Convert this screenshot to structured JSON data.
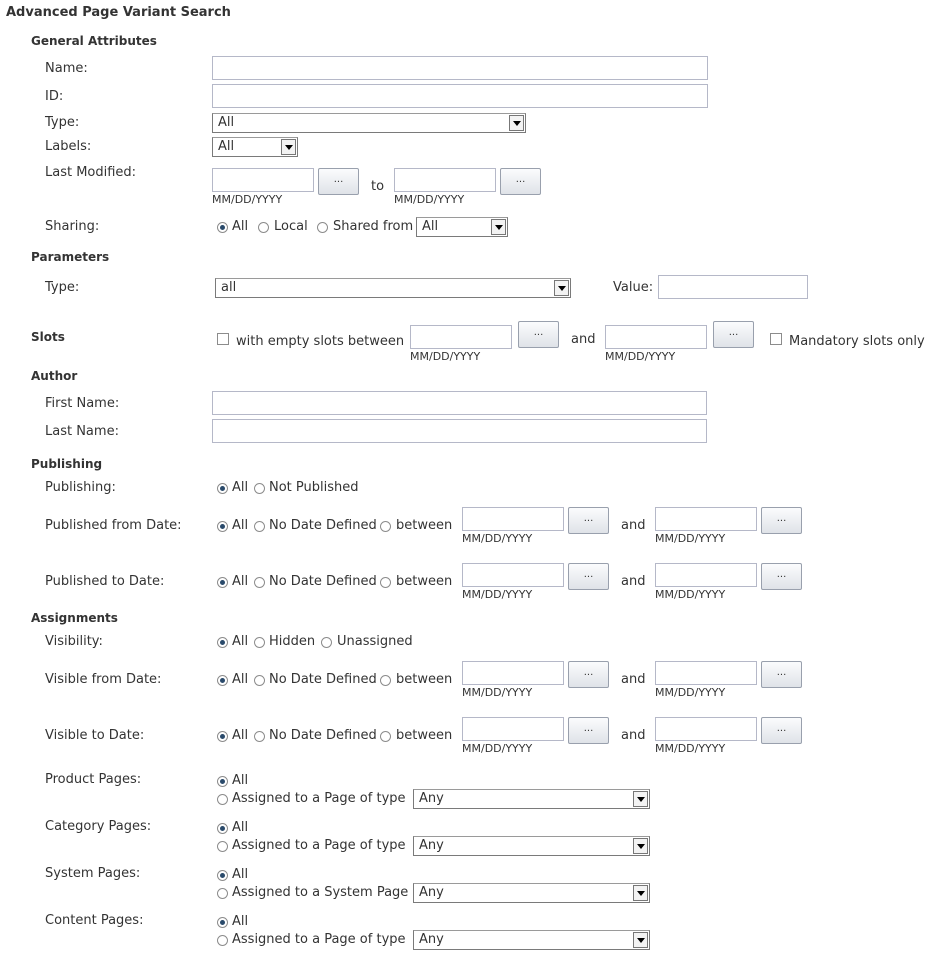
{
  "title": "Advanced Page Variant Search",
  "date_hint": "MM/DD/YYYY",
  "picker_label": "...",
  "general": {
    "heading": "General Attributes",
    "name_label": "Name:",
    "id_label": "ID:",
    "type_label": "Type:",
    "type_value": "All",
    "labels_label": "Labels:",
    "labels_value": "All",
    "last_modified_label": "Last Modified:",
    "to_label": "to",
    "sharing_label": "Sharing:",
    "sharing_options": [
      "All",
      "Local",
      "Shared from"
    ],
    "shared_from_value": "All"
  },
  "parameters": {
    "heading": "Parameters",
    "type_label": "Type:",
    "type_value": "all",
    "value_label": "Value:"
  },
  "slots": {
    "heading": "Slots",
    "empty_slots_label": "with empty slots between",
    "and_label": "and",
    "mandatory_label": "Mandatory slots only"
  },
  "author": {
    "heading": "Author",
    "first_name_label": "First Name:",
    "last_name_label": "Last Name:"
  },
  "publishing": {
    "heading": "Publishing",
    "publishing_label": "Publishing:",
    "publishing_options": [
      "All",
      "Not Published"
    ],
    "from_label": "Published from Date:",
    "to_label": "Published to Date:"
  },
  "date_options": [
    "All",
    "No Date Defined",
    "between"
  ],
  "and_label": "and",
  "assignments": {
    "heading": "Assignments",
    "visibility_label": "Visibility:",
    "visibility_options": [
      "All",
      "Hidden",
      "Unassigned"
    ],
    "visible_from_label": "Visible from Date:",
    "visible_to_label": "Visible to Date:",
    "product_label": "Product Pages:",
    "category_label": "Category Pages:",
    "system_label": "System Pages:",
    "content_label": "Content Pages:",
    "all_option": "All",
    "assigned_type_option": "Assigned to a Page of type",
    "assigned_system_option": "Assigned to a System Page",
    "any_value": "Any"
  }
}
